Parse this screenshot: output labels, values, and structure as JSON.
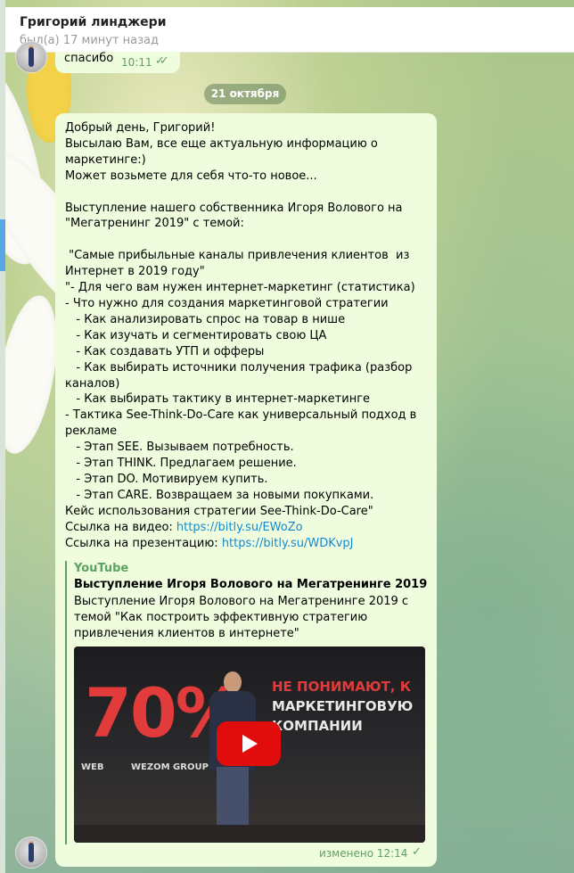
{
  "chat": {
    "contact_name": "Григорий линджери",
    "last_seen": "был(а) 17 минут назад"
  },
  "previous_message": {
    "text": "спасибо",
    "time": "10:11",
    "ticks": "✓✓"
  },
  "date_divider": "21 октября",
  "message": {
    "text": "Добрый день, Григорий!\nВысылаю Вам, все еще актуальную информацию о маркетинге:)\nМожет возьмете для себя что-то новое...\n\nВыступление нашего собственника Игоря Волового на \"Мегатренинг 2019\" с темой:\n\n \"Самые прибыльные каналы привлечения клиентов  из Интернет в 2019 году\"\n\"- Для чего вам нужен интернет-маркетинг (статистика)\n- Что нужно для создания маркетинговой стратегии\n   - Как анализировать спрос на товар в нише\n   - Как изучать и сегментировать свою ЦА\n   - Как создавать УТП и офферы\n   - Как выбирать источники получения трафика (разбор каналов)\n   - Как выбирать тактику в интернет-маркетинге\n- Тактика See-Think-Do-Care как универсальный подход в рекламе\n   - Этап SEE. Вызываем потребность.\n   - Этап THINK. Предлагаем решение.\n   - Этап DO. Мотивируем купить.\n   - Этап CARE. Возвращаем за новыми покупками.\nКейс использования стратегии See-Think-Do-Care\"\n",
    "video_label": "Ссылка на видео: ",
    "video_url": "https://bitly.su/EWoZo",
    "slides_label": "Ссылка на презентацию: ",
    "slides_url": "https://bitly.su/WDKvpJ",
    "status": "изменено 12:14",
    "check": "✓"
  },
  "link_preview": {
    "site": "YouTube",
    "title": "Выступление Игоря Волового на Мегатренинге 2019",
    "description": "Выступление Игоря Волового на Мегатренинге 2019 с темой \"Как построить эффективную стратегию привлечения клиентов в интернете\"",
    "thumbnail": {
      "percent": "70%",
      "line1": "НЕ ПОНИМАЮТ, К",
      "line2": "МАРКЕТИНГОВУЮ",
      "line3": "КОМПАНИИ",
      "logo_web": "WEB",
      "logo_wezom": "WEZOM GROUP"
    }
  },
  "colors": {
    "bubble": "#effdde",
    "accent_green": "#5fa061",
    "link": "#168acd",
    "play_red": "#e10d0d"
  }
}
